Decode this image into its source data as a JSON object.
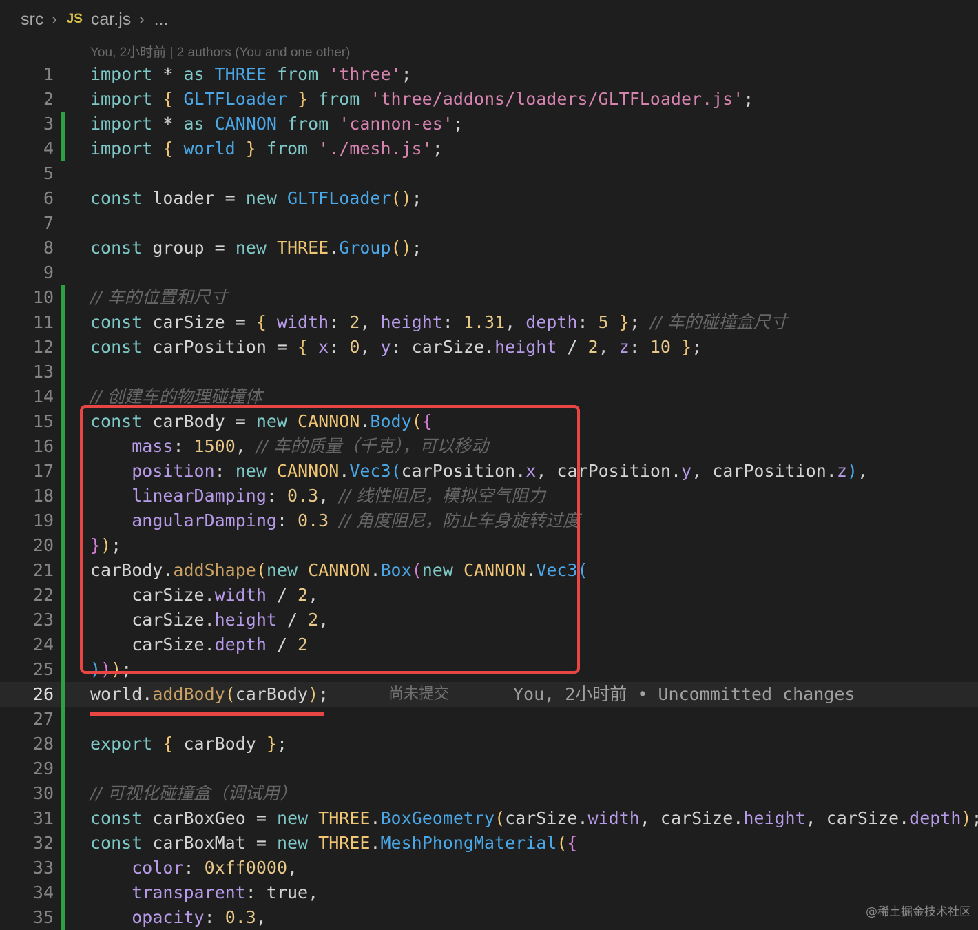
{
  "breadcrumb": {
    "folder": "src",
    "js_label": "JS",
    "file": "car.js",
    "more": "..."
  },
  "blame_header": "You, 2小时前 | 2 authors (You and one other)",
  "inline_blame": {
    "status": "尚未提交",
    "text": "You, 2小时前 • Uncommitted changes"
  },
  "active_line": "26",
  "lines": [
    {
      "n": "1",
      "modified": false
    },
    {
      "n": "2",
      "modified": false
    },
    {
      "n": "3",
      "modified": true
    },
    {
      "n": "4",
      "modified": true
    },
    {
      "n": "5",
      "modified": false
    },
    {
      "n": "6",
      "modified": false
    },
    {
      "n": "7",
      "modified": false
    },
    {
      "n": "8",
      "modified": false
    },
    {
      "n": "9",
      "modified": false
    },
    {
      "n": "10",
      "modified": true
    },
    {
      "n": "11",
      "modified": true
    },
    {
      "n": "12",
      "modified": true
    },
    {
      "n": "13",
      "modified": true
    },
    {
      "n": "14",
      "modified": true
    },
    {
      "n": "15",
      "modified": true
    },
    {
      "n": "16",
      "modified": true
    },
    {
      "n": "17",
      "modified": true
    },
    {
      "n": "18",
      "modified": true
    },
    {
      "n": "19",
      "modified": true
    },
    {
      "n": "20",
      "modified": true
    },
    {
      "n": "21",
      "modified": true
    },
    {
      "n": "22",
      "modified": true
    },
    {
      "n": "23",
      "modified": true
    },
    {
      "n": "24",
      "modified": true
    },
    {
      "n": "25",
      "modified": true
    },
    {
      "n": "26",
      "modified": true
    },
    {
      "n": "27",
      "modified": true
    },
    {
      "n": "28",
      "modified": true
    },
    {
      "n": "29",
      "modified": true
    },
    {
      "n": "30",
      "modified": true
    },
    {
      "n": "31",
      "modified": true
    },
    {
      "n": "32",
      "modified": true
    },
    {
      "n": "33",
      "modified": true
    },
    {
      "n": "34",
      "modified": true
    },
    {
      "n": "35",
      "modified": true
    }
  ],
  "code": [
    [
      [
        "kw",
        "import "
      ],
      [
        "ident",
        "* "
      ],
      [
        "kw",
        "as "
      ],
      [
        "p3",
        "THREE "
      ],
      [
        "kw",
        "from "
      ],
      [
        "str",
        "'three'"
      ],
      [
        "ident",
        ";"
      ]
    ],
    [
      [
        "kw",
        "import "
      ],
      [
        "p1",
        "{ "
      ],
      [
        "p3",
        "GLTFLoader "
      ],
      [
        "p1",
        "} "
      ],
      [
        "kw",
        "from "
      ],
      [
        "str",
        "'three/addons/loaders/GLTFLoader.js'"
      ],
      [
        "ident",
        ";"
      ]
    ],
    [
      [
        "kw",
        "import "
      ],
      [
        "ident",
        "* "
      ],
      [
        "kw",
        "as "
      ],
      [
        "p3",
        "CANNON "
      ],
      [
        "kw",
        "from "
      ],
      [
        "str",
        "'cannon-es'"
      ],
      [
        "ident",
        ";"
      ]
    ],
    [
      [
        "kw",
        "import "
      ],
      [
        "p1",
        "{ "
      ],
      [
        "p3",
        "world "
      ],
      [
        "p1",
        "} "
      ],
      [
        "kw",
        "from "
      ],
      [
        "str",
        "'./mesh.js'"
      ],
      [
        "ident",
        ";"
      ]
    ],
    [],
    [
      [
        "kw",
        "const "
      ],
      [
        "ident",
        "loader = "
      ],
      [
        "kw",
        "new "
      ],
      [
        "p3",
        "GLTFLoader"
      ],
      [
        "p1",
        "()"
      ],
      [
        "ident",
        ";"
      ]
    ],
    [],
    [
      [
        "kw",
        "const "
      ],
      [
        "ident",
        "group = "
      ],
      [
        "kw",
        "new "
      ],
      [
        "caps",
        "THREE"
      ],
      [
        "ident",
        "."
      ],
      [
        "p3",
        "Group"
      ],
      [
        "p1",
        "()"
      ],
      [
        "ident",
        ";"
      ]
    ],
    [],
    [
      [
        "cmt",
        "// 车的位置和尺寸"
      ]
    ],
    [
      [
        "kw",
        "const "
      ],
      [
        "ident",
        "carSize = "
      ],
      [
        "p1",
        "{ "
      ],
      [
        "prop",
        "width"
      ],
      [
        "ident",
        ": "
      ],
      [
        "num",
        "2"
      ],
      [
        "ident",
        ", "
      ],
      [
        "prop",
        "height"
      ],
      [
        "ident",
        ": "
      ],
      [
        "num",
        "1.31"
      ],
      [
        "ident",
        ", "
      ],
      [
        "prop",
        "depth"
      ],
      [
        "ident",
        ": "
      ],
      [
        "num",
        "5 "
      ],
      [
        "p1",
        "}"
      ],
      [
        "ident",
        "; "
      ],
      [
        "cmt",
        "// 车的碰撞盒尺寸"
      ]
    ],
    [
      [
        "kw",
        "const "
      ],
      [
        "ident",
        "carPosition = "
      ],
      [
        "p1",
        "{ "
      ],
      [
        "prop",
        "x"
      ],
      [
        "ident",
        ": "
      ],
      [
        "num",
        "0"
      ],
      [
        "ident",
        ", "
      ],
      [
        "prop",
        "y"
      ],
      [
        "ident",
        ": carSize."
      ],
      [
        "prop",
        "height "
      ],
      [
        "ident",
        "/ "
      ],
      [
        "num",
        "2"
      ],
      [
        "ident",
        ", "
      ],
      [
        "prop",
        "z"
      ],
      [
        "ident",
        ": "
      ],
      [
        "num",
        "10 "
      ],
      [
        "p1",
        "}"
      ],
      [
        "ident",
        ";"
      ]
    ],
    [],
    [
      [
        "cmt",
        "// 创建车的物理碰撞体"
      ]
    ],
    [
      [
        "kw",
        "const "
      ],
      [
        "ident",
        "carBody = "
      ],
      [
        "kw",
        "new "
      ],
      [
        "caps",
        "CANNON"
      ],
      [
        "ident",
        "."
      ],
      [
        "p3",
        "Body"
      ],
      [
        "p1",
        "("
      ],
      [
        "p2",
        "{"
      ]
    ],
    [
      [
        "ident",
        "    "
      ],
      [
        "prop",
        "mass"
      ],
      [
        "ident",
        ": "
      ],
      [
        "num",
        "1500"
      ],
      [
        "ident",
        ", "
      ],
      [
        "cmt",
        "// 车的质量（千克），可以移动"
      ]
    ],
    [
      [
        "ident",
        "    "
      ],
      [
        "prop",
        "position"
      ],
      [
        "ident",
        ": "
      ],
      [
        "kw",
        "new "
      ],
      [
        "caps",
        "CANNON"
      ],
      [
        "ident",
        "."
      ],
      [
        "p3",
        "Vec3"
      ],
      [
        "p3",
        "("
      ],
      [
        "ident",
        "carPosition."
      ],
      [
        "prop",
        "x"
      ],
      [
        "ident",
        ", carPosition."
      ],
      [
        "prop",
        "y"
      ],
      [
        "ident",
        ", carPosition."
      ],
      [
        "prop",
        "z"
      ],
      [
        "p3",
        ")"
      ],
      [
        "ident",
        ","
      ]
    ],
    [
      [
        "ident",
        "    "
      ],
      [
        "prop",
        "linearDamping"
      ],
      [
        "ident",
        ": "
      ],
      [
        "num",
        "0.3"
      ],
      [
        "ident",
        ", "
      ],
      [
        "cmt",
        "// 线性阻尼，模拟空气阻力"
      ]
    ],
    [
      [
        "ident",
        "    "
      ],
      [
        "prop",
        "angularDamping"
      ],
      [
        "ident",
        ": "
      ],
      [
        "num",
        "0.3 "
      ],
      [
        "cmt",
        "// 角度阻尼，防止车身旋转过度"
      ]
    ],
    [
      [
        "p2",
        "}"
      ],
      [
        "p1",
        ")"
      ],
      [
        "ident",
        ";"
      ]
    ],
    [
      [
        "ident",
        "carBody."
      ],
      [
        "fn",
        "addShape"
      ],
      [
        "p1",
        "("
      ],
      [
        "kw",
        "new "
      ],
      [
        "caps",
        "CANNON"
      ],
      [
        "ident",
        "."
      ],
      [
        "p3",
        "Box"
      ],
      [
        "p2",
        "("
      ],
      [
        "kw",
        "new "
      ],
      [
        "caps",
        "CANNON"
      ],
      [
        "ident",
        "."
      ],
      [
        "p3",
        "Vec3"
      ],
      [
        "p3",
        "("
      ]
    ],
    [
      [
        "ident",
        "    carSize."
      ],
      [
        "prop",
        "width "
      ],
      [
        "ident",
        "/ "
      ],
      [
        "num",
        "2"
      ],
      [
        "ident",
        ","
      ]
    ],
    [
      [
        "ident",
        "    carSize."
      ],
      [
        "prop",
        "height "
      ],
      [
        "ident",
        "/ "
      ],
      [
        "num",
        "2"
      ],
      [
        "ident",
        ","
      ]
    ],
    [
      [
        "ident",
        "    carSize."
      ],
      [
        "prop",
        "depth "
      ],
      [
        "ident",
        "/ "
      ],
      [
        "num",
        "2"
      ]
    ],
    [
      [
        "p3",
        ")"
      ],
      [
        "p2",
        ")"
      ],
      [
        "p1",
        ")"
      ],
      [
        "ident",
        ";"
      ]
    ],
    [
      [
        "ident",
        "world."
      ],
      [
        "fn",
        "addBody"
      ],
      [
        "p1",
        "("
      ],
      [
        "ident",
        "carBody"
      ],
      [
        "p1",
        ")"
      ],
      [
        "ident",
        ";"
      ]
    ],
    [],
    [
      [
        "kw",
        "export "
      ],
      [
        "p1",
        "{ "
      ],
      [
        "ident",
        "carBody "
      ],
      [
        "p1",
        "}"
      ],
      [
        "ident",
        ";"
      ]
    ],
    [],
    [
      [
        "cmt",
        "// 可视化碰撞盒（调试用）"
      ]
    ],
    [
      [
        "kw",
        "const "
      ],
      [
        "ident",
        "carBoxGeo = "
      ],
      [
        "kw",
        "new "
      ],
      [
        "caps",
        "THREE"
      ],
      [
        "ident",
        "."
      ],
      [
        "p3",
        "BoxGeometry"
      ],
      [
        "p1",
        "("
      ],
      [
        "ident",
        "carSize."
      ],
      [
        "prop",
        "width"
      ],
      [
        "ident",
        ", carSize."
      ],
      [
        "prop",
        "height"
      ],
      [
        "ident",
        ", carSize."
      ],
      [
        "prop",
        "depth"
      ],
      [
        "p1",
        ")"
      ],
      [
        "ident",
        ";"
      ]
    ],
    [
      [
        "kw",
        "const "
      ],
      [
        "ident",
        "carBoxMat = "
      ],
      [
        "kw",
        "new "
      ],
      [
        "caps",
        "THREE"
      ],
      [
        "ident",
        "."
      ],
      [
        "p3",
        "MeshPhongMaterial"
      ],
      [
        "p1",
        "("
      ],
      [
        "p2",
        "{"
      ]
    ],
    [
      [
        "ident",
        "    "
      ],
      [
        "prop",
        "color"
      ],
      [
        "ident",
        ": "
      ],
      [
        "num",
        "0xff0000"
      ],
      [
        "ident",
        ","
      ]
    ],
    [
      [
        "ident",
        "    "
      ],
      [
        "prop",
        "transparent"
      ],
      [
        "ident",
        ": "
      ],
      [
        "ident",
        "true,"
      ]
    ],
    [
      [
        "ident",
        "    "
      ],
      [
        "prop",
        "opacity"
      ],
      [
        "ident",
        ": "
      ],
      [
        "num",
        "0.3"
      ],
      [
        "ident",
        ","
      ]
    ]
  ],
  "watermark": "@稀土掘金技术社区",
  "colors": {
    "background": "#1e1e1e",
    "gutter_modified": "#2ea043",
    "annotation_red": "#e84545"
  }
}
